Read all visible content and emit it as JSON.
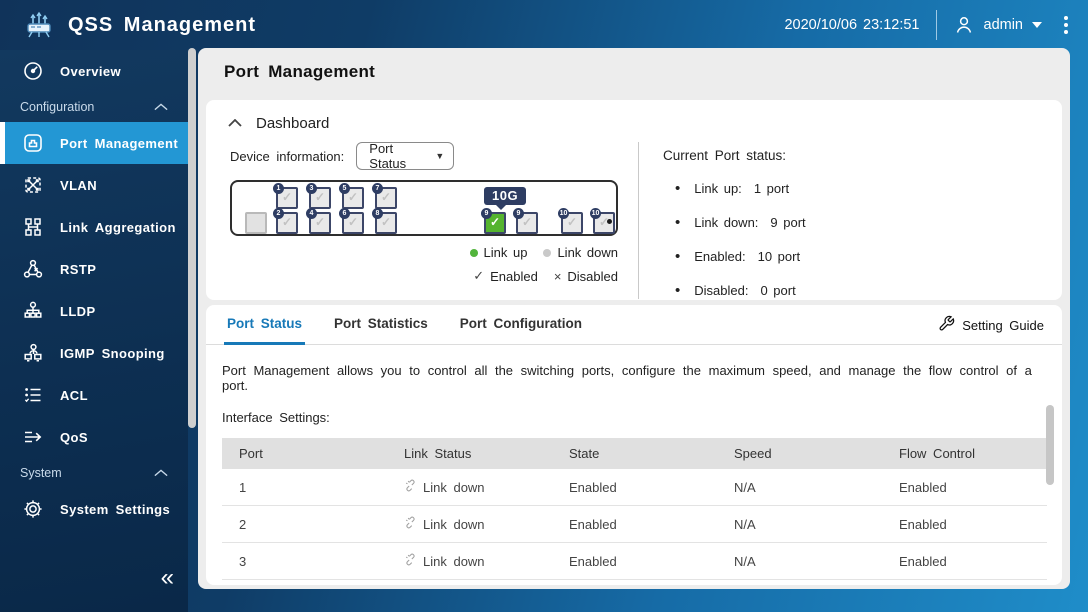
{
  "colors": {
    "accent_blue": "#2397d4",
    "tab_active_blue": "#1779b8",
    "link_up_green": "#55b42f",
    "link_down_gray": "#c9c9c9",
    "badge_navy": "#2e3d63"
  },
  "header": {
    "app_title": "QSS Management",
    "datetime": "2020/10/06 23:12:51",
    "username": "admin"
  },
  "sidebar": {
    "items": [
      {
        "label": "Overview",
        "icon": "gauge-icon"
      },
      {
        "label": "Configuration",
        "icon": "chevron-up-icon",
        "section": true
      },
      {
        "label": "Port Management",
        "icon": "ethernet-port-icon",
        "active": true
      },
      {
        "label": "VLAN",
        "icon": "vlan-icon"
      },
      {
        "label": "Link Aggregation",
        "icon": "link-aggregation-icon"
      },
      {
        "label": "RSTP",
        "icon": "rstp-icon"
      },
      {
        "label": "LLDP",
        "icon": "lldp-icon"
      },
      {
        "label": "IGMP Snooping",
        "icon": "igmp-snooping-icon"
      },
      {
        "label": "ACL",
        "icon": "acl-icon"
      },
      {
        "label": "QoS",
        "icon": "qos-icon"
      },
      {
        "label": "System",
        "icon": "chevron-up-icon",
        "section": true
      },
      {
        "label": "System Settings",
        "icon": "gear-icon"
      }
    ],
    "collapse_glyph": "«"
  },
  "main": {
    "page_title": "Port Management",
    "dashboard": {
      "title": "Dashboard",
      "device_info_label": "Device information:",
      "device_dropdown_value": "Port Status",
      "speed_badge": "10G",
      "ports": {
        "top": [
          "1",
          "3",
          "5",
          "7"
        ],
        "bottom": [
          "2",
          "4",
          "6",
          "8"
        ],
        "right": [
          "9",
          "9",
          "10",
          "10"
        ],
        "right_link_states": [
          "up",
          "down",
          "down",
          "down"
        ]
      },
      "legend": {
        "link_up": "Link up",
        "link_down": "Link down",
        "enabled": "Enabled",
        "disabled": "Disabled",
        "enabled_glyph": "✓",
        "disabled_glyph": "×"
      },
      "status": {
        "title": "Current Port status:",
        "items": [
          {
            "label": "Link up:",
            "value": "1 port"
          },
          {
            "label": "Link down:",
            "value": "9 port"
          },
          {
            "label": "Enabled:",
            "value": "10 port"
          },
          {
            "label": "Disabled:",
            "value": "0 port"
          }
        ]
      }
    },
    "tabs": [
      {
        "label": "Port Status",
        "active": true
      },
      {
        "label": "Port Statistics"
      },
      {
        "label": "Port Configuration"
      }
    ],
    "setting_guide_label": "Setting Guide",
    "description": "Port Management allows you to control all the switching ports, configure the maximum speed, and manage the flow control of a port.",
    "interface_settings_label": "Interface Settings:",
    "table": {
      "columns": [
        "Port",
        "Link Status",
        "State",
        "Speed",
        "Flow Control"
      ],
      "rows": [
        {
          "port": "1",
          "link_status": "Link down",
          "state": "Enabled",
          "speed": "N/A",
          "flow_control": "Enabled"
        },
        {
          "port": "2",
          "link_status": "Link down",
          "state": "Enabled",
          "speed": "N/A",
          "flow_control": "Enabled"
        },
        {
          "port": "3",
          "link_status": "Link down",
          "state": "Enabled",
          "speed": "N/A",
          "flow_control": "Enabled"
        }
      ]
    }
  }
}
